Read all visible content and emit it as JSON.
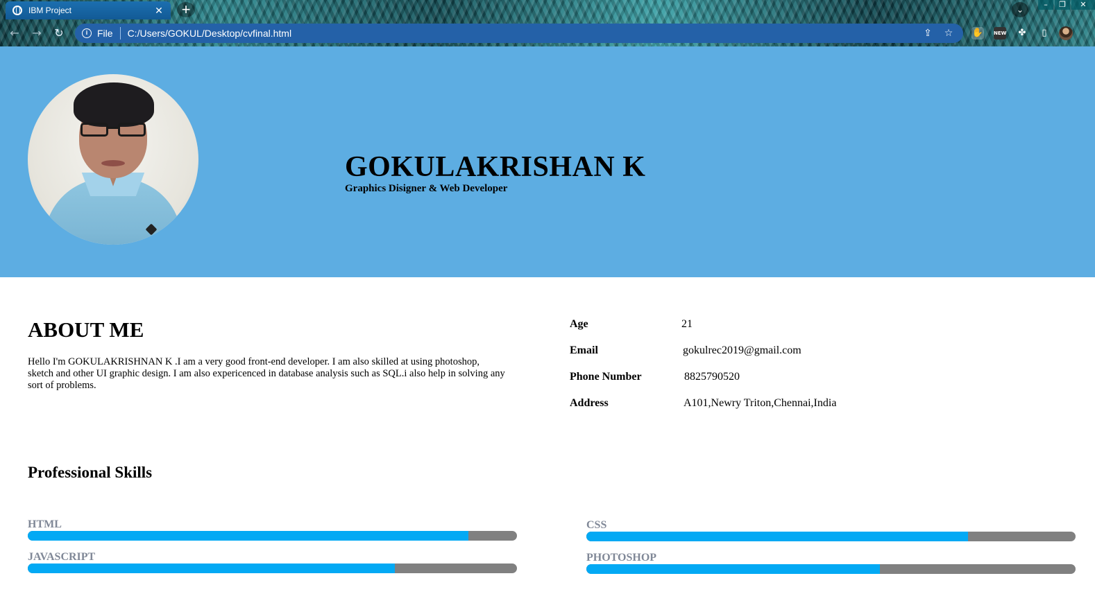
{
  "browser": {
    "tab_title": "IBM Project",
    "tab_close": "✕",
    "new_tab": "+",
    "scheme": "File",
    "url": "C:/Users/GOKUL/Desktop/cvfinal.html",
    "icons": [
      "globe-icon",
      "back-icon",
      "forward-icon",
      "reload-icon",
      "info-icon",
      "share-icon",
      "star-icon",
      "extensions-icon",
      "sidepanel-icon",
      "profile-avatar"
    ]
  },
  "header": {
    "name": "GOKULAKRISHAN K",
    "role": "Graphics Disigner & Web Developer",
    "background": "#5dade2"
  },
  "about": {
    "title": "ABOUT ME",
    "text": "Hello I'm GOKULAKRISHNAN K .I am a very good front-end developer. I am also skilled at using photoshop, sketch and other UI graphic design. I am also expericenced in database analysis such as SQL.i also help in solving any sort of problems."
  },
  "info": [
    {
      "label": "Age",
      "value": "21"
    },
    {
      "label": "Email",
      "value": "gokulrec2019@gmail.com"
    },
    {
      "label": "Phone Number",
      "value": "8825790520"
    },
    {
      "label": "Address",
      "value": "A101,Newry Triton,Chennai,India"
    }
  ],
  "skills": {
    "title": "Professional Skills",
    "fill_color": "#03a9f4",
    "track_color": "#808080",
    "items": [
      {
        "name": "HTML",
        "level": 0.9
      },
      {
        "name": "CSS",
        "level": 0.78
      },
      {
        "name": "JAVASCRIPT",
        "level": 0.75
      },
      {
        "name": "PHOTOSHOP",
        "level": 0.6
      }
    ]
  }
}
